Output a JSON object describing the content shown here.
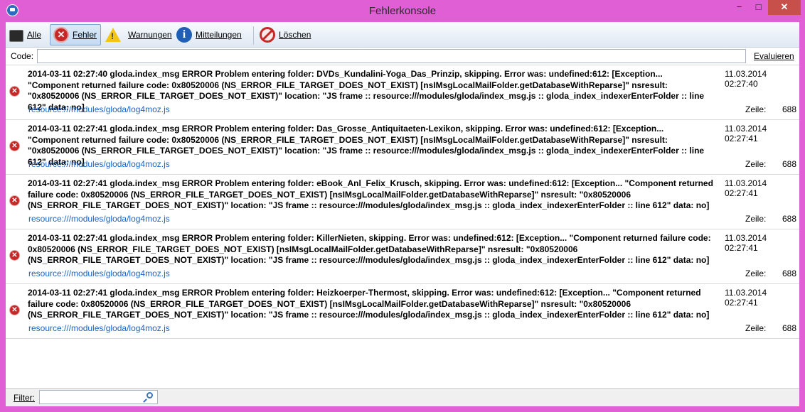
{
  "window": {
    "title": "Fehlerkonsole"
  },
  "toolbar": {
    "all": "Alle",
    "errors": "Fehler",
    "warnings": "Warnungen",
    "messages": "Mitteilungen",
    "clear": "Löschen"
  },
  "code": {
    "label": "Code:",
    "value": "",
    "evaluate": "Evaluieren"
  },
  "entries": [
    {
      "message": "2014-03-11 02:27:40 gloda.index_msg ERROR   Problem entering folder: DVDs_Kundalini-Yoga_Das_Prinzip, skipping. Error was: undefined:612: [Exception... \"Component returned failure code: 0x80520006 (NS_ERROR_FILE_TARGET_DOES_NOT_EXIST) [nsIMsgLocalMailFolder.getDatabaseWithReparse]\"  nsresult: \"0x80520006 (NS_ERROR_FILE_TARGET_DOES_NOT_EXIST)\"  location: \"JS frame :: resource:///modules/gloda/index_msg.js :: gloda_index_indexerEnterFolder :: line 612\"  data: no]",
      "timestamp": "11.03.2014 02:27:40",
      "source": "resource:///modules/gloda/log4moz.js",
      "line_label": "Zeile:",
      "line": "688"
    },
    {
      "message": "2014-03-11 02:27:41 gloda.index_msg ERROR   Problem entering folder: Das_Grosse_Antiquitaeten-Lexikon, skipping. Error was: undefined:612: [Exception... \"Component returned failure code: 0x80520006 (NS_ERROR_FILE_TARGET_DOES_NOT_EXIST) [nsIMsgLocalMailFolder.getDatabaseWithReparse]\"  nsresult: \"0x80520006 (NS_ERROR_FILE_TARGET_DOES_NOT_EXIST)\"  location: \"JS frame :: resource:///modules/gloda/index_msg.js :: gloda_index_indexerEnterFolder :: line 612\"  data: no]",
      "timestamp": "11.03.2014 02:27:41",
      "source": "resource:///modules/gloda/log4moz.js",
      "line_label": "Zeile:",
      "line": "688"
    },
    {
      "message": "2014-03-11 02:27:41 gloda.index_msg ERROR   Problem entering folder: eBook_Anl_Felix_Krusch, skipping. Error was: undefined:612: [Exception... \"Component returned failure code: 0x80520006 (NS_ERROR_FILE_TARGET_DOES_NOT_EXIST) [nsIMsgLocalMailFolder.getDatabaseWithReparse]\"  nsresult: \"0x80520006 (NS_ERROR_FILE_TARGET_DOES_NOT_EXIST)\"  location: \"JS frame :: resource:///modules/gloda/index_msg.js :: gloda_index_indexerEnterFolder :: line 612\"  data: no]",
      "timestamp": "11.03.2014 02:27:41",
      "source": "resource:///modules/gloda/log4moz.js",
      "line_label": "Zeile:",
      "line": "688"
    },
    {
      "message": "2014-03-11 02:27:41 gloda.index_msg ERROR   Problem entering folder: KillerNieten, skipping. Error was: undefined:612: [Exception... \"Component returned failure code: 0x80520006 (NS_ERROR_FILE_TARGET_DOES_NOT_EXIST) [nsIMsgLocalMailFolder.getDatabaseWithReparse]\"  nsresult: \"0x80520006 (NS_ERROR_FILE_TARGET_DOES_NOT_EXIST)\"  location: \"JS frame :: resource:///modules/gloda/index_msg.js :: gloda_index_indexerEnterFolder :: line 612\"  data: no]",
      "timestamp": "11.03.2014 02:27:41",
      "source": "resource:///modules/gloda/log4moz.js",
      "line_label": "Zeile:",
      "line": "688"
    },
    {
      "message": "2014-03-11 02:27:41 gloda.index_msg ERROR   Problem entering folder: Heizkoerper-Thermost, skipping. Error was: undefined:612: [Exception... \"Component returned failure code: 0x80520006 (NS_ERROR_FILE_TARGET_DOES_NOT_EXIST) [nsIMsgLocalMailFolder.getDatabaseWithReparse]\"  nsresult: \"0x80520006 (NS_ERROR_FILE_TARGET_DOES_NOT_EXIST)\"  location: \"JS frame :: resource:///modules/gloda/index_msg.js :: gloda_index_indexerEnterFolder :: line 612\"  data: no]",
      "timestamp": "11.03.2014 02:27:41",
      "source": "resource:///modules/gloda/log4moz.js",
      "line_label": "Zeile:",
      "line": "688"
    }
  ],
  "filter": {
    "label": "Filter:",
    "value": ""
  },
  "icons": {
    "app": "thunderbird-icon",
    "all": "console-icon",
    "errors": "error-icon",
    "warnings": "warning-icon",
    "messages": "info-icon",
    "clear": "clear-icon",
    "search": "search-icon"
  },
  "colors": {
    "frame": "#e05fd4",
    "link": "#1a64c8",
    "error": "#c62828",
    "close": "#c7504a"
  }
}
